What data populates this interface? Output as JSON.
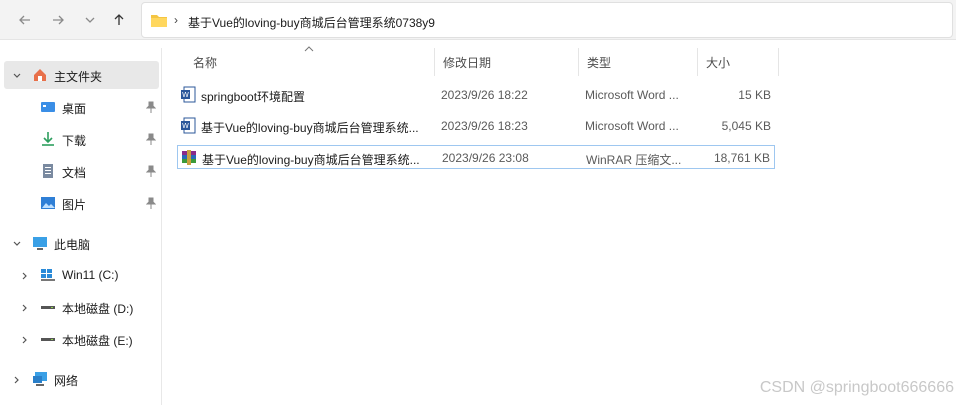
{
  "address_bar": {
    "separator": "›",
    "path": "基于Vue的loving-buy商城后台管理系统0738y9"
  },
  "sidebar": {
    "items": [
      {
        "label": "主文件夹",
        "icon": "home-icon",
        "chevron": "expanded"
      },
      {
        "label": "桌面",
        "icon": "desktop-icon",
        "pinned": true
      },
      {
        "label": "下载",
        "icon": "download-icon",
        "pinned": true
      },
      {
        "label": "文档",
        "icon": "document-icon",
        "pinned": true
      },
      {
        "label": "图片",
        "icon": "picture-icon",
        "pinned": true
      },
      {
        "label": "此电脑",
        "icon": "computer-icon",
        "chevron": "expanded"
      },
      {
        "label": "Win11 (C:)",
        "icon": "windows-drive-icon",
        "chevron": "collapsed"
      },
      {
        "label": "本地磁盘 (D:)",
        "icon": "drive-icon",
        "chevron": "collapsed"
      },
      {
        "label": "本地磁盘 (E:)",
        "icon": "drive-icon",
        "chevron": "collapsed"
      },
      {
        "label": "网络",
        "icon": "network-icon",
        "chevron": "collapsed"
      }
    ]
  },
  "columns": {
    "name": "名称",
    "modified": "修改日期",
    "type": "类型",
    "size": "大小"
  },
  "files": [
    {
      "name": "springboot环境配置",
      "modified": "2023/9/26 18:22",
      "type": "Microsoft Word ...",
      "size": "15 KB",
      "icon": "word-document-icon"
    },
    {
      "name": "基于Vue的loving-buy商城后台管理系统...",
      "modified": "2023/9/26 18:23",
      "type": "Microsoft Word ...",
      "size": "5,045 KB",
      "icon": "word-document-icon"
    },
    {
      "name": "基于Vue的loving-buy商城后台管理系统...",
      "modified": "2023/9/26 23:08",
      "type": "WinRAR 压缩文...",
      "size": "18,761 KB",
      "icon": "winrar-archive-icon"
    }
  ],
  "watermark": "CSDN @springboot666666",
  "colors": {
    "selection_border": "#9ec7f0",
    "folder_yellow": "#f4c542",
    "word_blue": "#2b579a"
  }
}
